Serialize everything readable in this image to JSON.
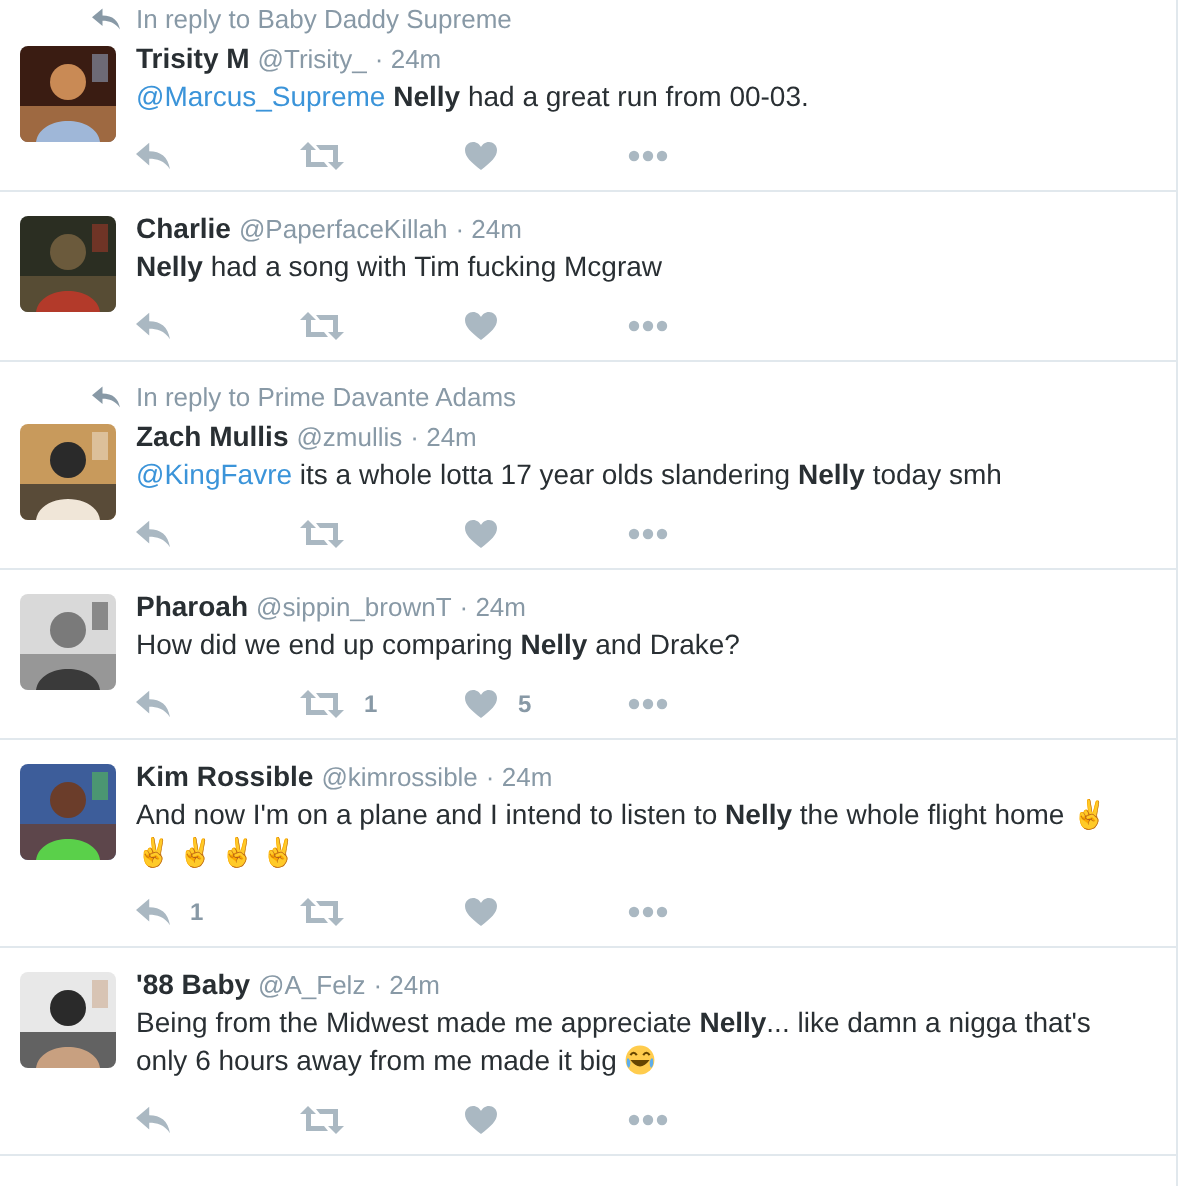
{
  "tweets": [
    {
      "in_reply_to": "In reply to Baby Daddy Supreme",
      "name": "Trisity M",
      "handle": "@Trisity_",
      "time": "· 24m",
      "body": [
        {
          "kind": "mention",
          "text": "@Marcus_Supreme"
        },
        {
          "kind": "text",
          "text": " **Nelly** had a great run from 00-03."
        }
      ]
    },
    {
      "name": "Charlie",
      "handle": "@PaperfaceKillah",
      "time": "· 24m",
      "body": [
        {
          "kind": "text",
          "text": "**Nelly** had a song with Tim fucking Mcgraw"
        }
      ]
    },
    {
      "in_reply_to": "In reply to Prime Davante Adams",
      "name": "Zach Mullis",
      "handle": "@zmullis",
      "time": "· 24m",
      "body": [
        {
          "kind": "mention",
          "text": "@KingFavre"
        },
        {
          "kind": "text",
          "text": " its a whole lotta 17 year olds slandering **Nelly** today smh"
        }
      ]
    },
    {
      "name": "Pharoah",
      "handle": "@sippin_brownT",
      "time": "· 24m",
      "body": [
        {
          "kind": "text",
          "text": "How did we end up comparing **Nelly** and Drake?"
        }
      ],
      "retweets": "1",
      "likes": "5"
    },
    {
      "name": "Kim Rossible",
      "handle": "@kimrossible",
      "time": "· 24m",
      "body": [
        {
          "kind": "text",
          "text": "And now I'm on a plane and I intend to listen to **Nelly** the whole flight home ✌ ✌ ✌ ✌ ✌"
        }
      ],
      "replies": "1"
    },
    {
      "name": "'88 Baby",
      "handle": "@A_Felz",
      "time": "· 24m",
      "body": [
        {
          "kind": "text",
          "text": "Being from the Midwest made me appreciate **Nelly**... like damn a nigga that's only 6 hours away from me made it big "
        },
        {
          "kind": "emoji"
        }
      ]
    }
  ]
}
